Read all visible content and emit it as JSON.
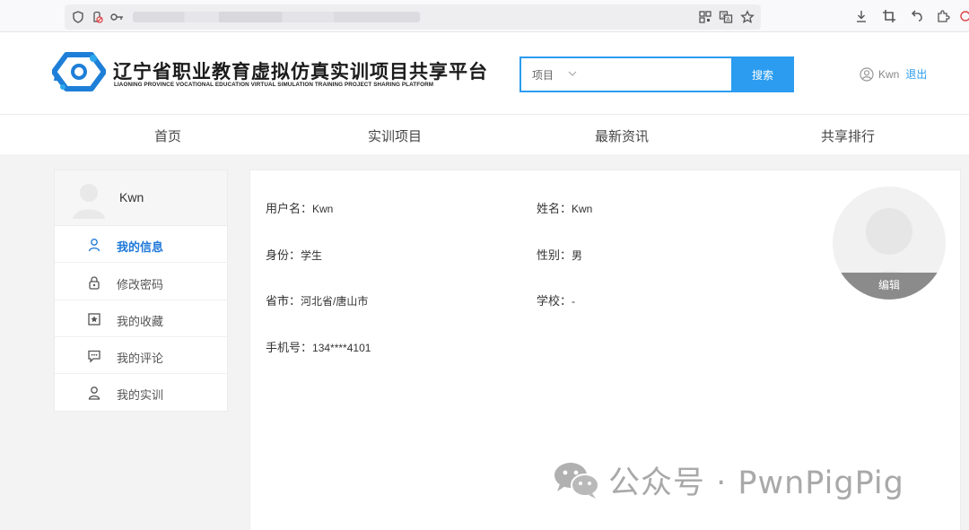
{
  "browser": {
    "icons": [
      "shield-icon",
      "tracking-blocked-icon",
      "key-icon",
      "qr-code-icon",
      "translate-icon",
      "star-icon",
      "download-icon",
      "crop-icon",
      "undo-icon",
      "extensions-icon",
      "record-icon"
    ]
  },
  "header": {
    "title": "辽宁省职业教育虚拟仿真实训项目共享平台",
    "subtitle": "LIAONING PROVINCE VOCATIONAL EDUCATION VIRTUAL SIMULATION TRAINING PROJECT SHARING PLATFORM",
    "search": {
      "type_label": "项目",
      "value": "",
      "button_label": "搜索"
    },
    "user": {
      "name": "Kwn",
      "logout_label": "退出"
    },
    "accent_color": "#2b9cf0"
  },
  "nav": {
    "items": [
      {
        "label": "首页"
      },
      {
        "label": "实训项目"
      },
      {
        "label": "最新资讯"
      },
      {
        "label": "共享排行"
      }
    ]
  },
  "sidebar": {
    "username": "Kwn",
    "items": [
      {
        "label": "我的信息",
        "icon": "user-icon",
        "active": true
      },
      {
        "label": "修改密码",
        "icon": "lock-icon",
        "active": false
      },
      {
        "label": "我的收藏",
        "icon": "bookmark-star-icon",
        "active": false
      },
      {
        "label": "我的评论",
        "icon": "comment-icon",
        "active": false
      },
      {
        "label": "我的实训",
        "icon": "user-icon",
        "active": false
      }
    ],
    "active_color": "#1e78d8"
  },
  "profile": {
    "username": {
      "label": "用户名：",
      "value": "Kwn"
    },
    "name": {
      "label": "姓名：",
      "value": "Kwn"
    },
    "role": {
      "label": "身份：",
      "value": "学生"
    },
    "gender": {
      "label": "性别：",
      "value": "男"
    },
    "region": {
      "label": "省市：",
      "value": "河北省/唐山市"
    },
    "school": {
      "label": "学校：",
      "value": "-"
    },
    "phone": {
      "label": "手机号：",
      "value": "134****4101"
    },
    "avatar_edit_label": "编辑"
  },
  "watermark": {
    "text": "公众号 · PwnPigPig"
  }
}
